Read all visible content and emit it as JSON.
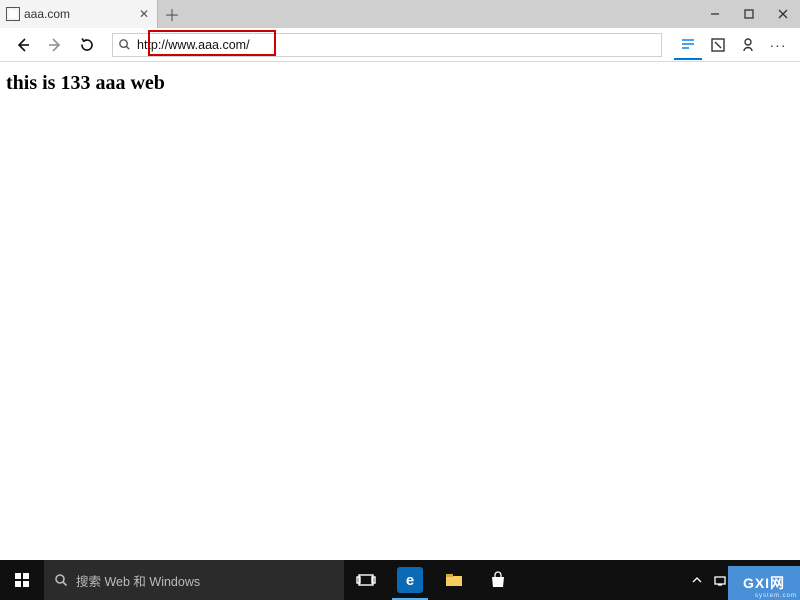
{
  "tabs": {
    "active": {
      "title": "aaa.com"
    }
  },
  "address_bar": {
    "url": "http://www.aaa.com/"
  },
  "page": {
    "heading": "this is 133 aaa web"
  },
  "taskbar": {
    "search_placeholder": "搜索 Web 和 Windows"
  },
  "watermark": {
    "brand": "GXI网",
    "sub": "system.com"
  }
}
